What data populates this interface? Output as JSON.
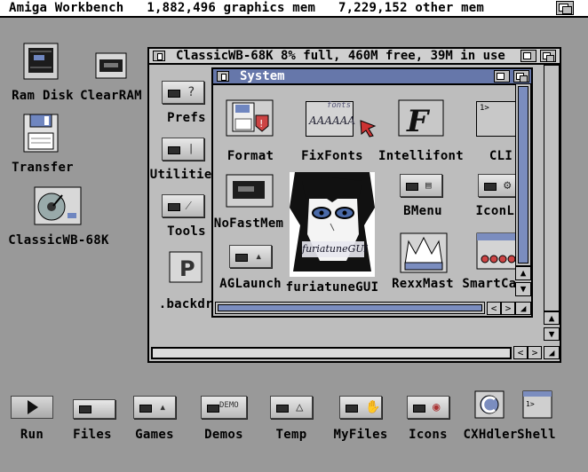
{
  "screen_title": "Amiga Workbench   1,882,496 graphics mem   7,229,152 other mem",
  "desktop_icons": [
    {
      "id": "ramdisk",
      "label": "Ram Disk"
    },
    {
      "id": "clearram",
      "label": "ClearRAM"
    },
    {
      "id": "transfer",
      "label": "Transfer"
    },
    {
      "id": "classicwb",
      "label": "ClassicWB-68K"
    }
  ],
  "dock_items": [
    {
      "id": "run",
      "label": "Run"
    },
    {
      "id": "files",
      "label": "Files"
    },
    {
      "id": "games",
      "label": "Games"
    },
    {
      "id": "demos",
      "label": "Demos"
    },
    {
      "id": "temp",
      "label": "Temp"
    },
    {
      "id": "myfiles",
      "label": "MyFiles"
    },
    {
      "id": "icons",
      "label": "Icons"
    },
    {
      "id": "cxhdler",
      "label": "CXHdler"
    },
    {
      "id": "shell",
      "label": "Shell"
    }
  ],
  "classic_window": {
    "title": "ClassicWB-68K  8% full, 460M free, 39M in use",
    "items": [
      {
        "id": "prefs",
        "label": "Prefs"
      },
      {
        "id": "utilities",
        "label": "Utilities"
      },
      {
        "id": "tools",
        "label": "Tools"
      },
      {
        "id": "backdrop",
        "label": ".backdrop"
      }
    ]
  },
  "system_window": {
    "title": "System",
    "items": [
      {
        "id": "format",
        "label": "Format"
      },
      {
        "id": "fixfonts",
        "label": "FixFonts"
      },
      {
        "id": "intellifont",
        "label": "Intellifont"
      },
      {
        "id": "cli",
        "label": "CLI"
      },
      {
        "id": "nofastmem",
        "label": "NoFastMem"
      },
      {
        "id": "bmenu",
        "label": "BMenu"
      },
      {
        "id": "iconlib",
        "label": "IconLib"
      },
      {
        "id": "aglaunch",
        "label": "AGLaunch"
      },
      {
        "id": "furiatunegui",
        "label": "furiatuneGUI"
      },
      {
        "id": "rexxmast",
        "label": "RexxMast"
      },
      {
        "id": "smartcache",
        "label": "SmartCache"
      }
    ],
    "furiatune_text": "furiatuneGUI",
    "fixfonts_text": "AAAAAA",
    "fixfonts_sub": "fonts",
    "cli_text": "1>"
  },
  "colors": {
    "screen_bg": "#999999",
    "title_bg": "#ffffff",
    "active_title": "#6677aa",
    "window_bg": "#bfbfbf",
    "accent": "#7b8dbf"
  }
}
